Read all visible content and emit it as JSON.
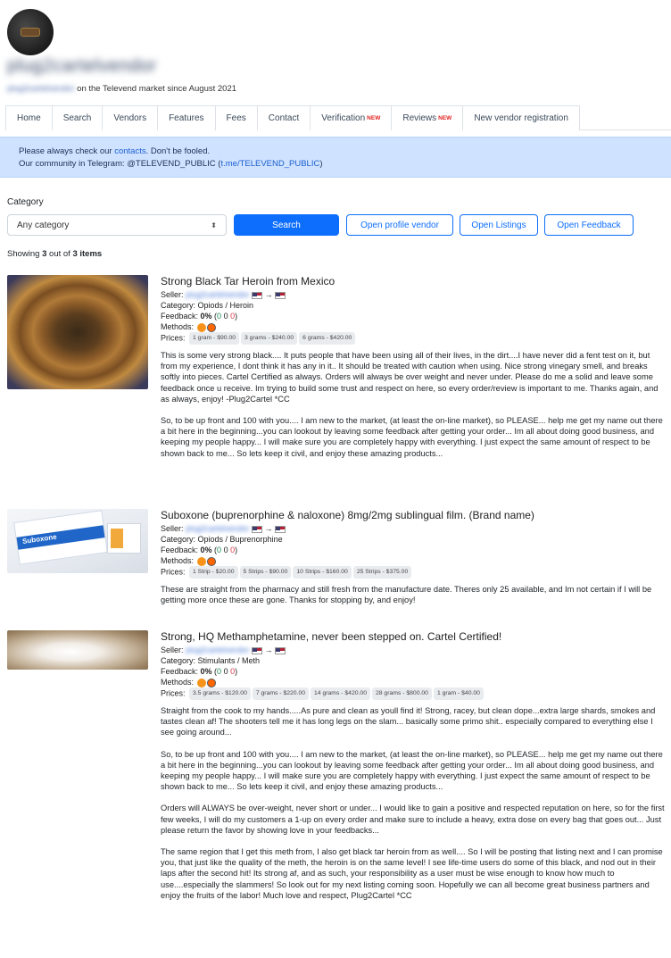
{
  "header": {
    "vendor_name": "plug2cartelvendor",
    "since_prefix": "plug2cartelvendor",
    "since_text": " on the Televend market since August 2021"
  },
  "nav": {
    "items": [
      {
        "label": "Home",
        "new": ""
      },
      {
        "label": "Search",
        "new": ""
      },
      {
        "label": "Vendors",
        "new": ""
      },
      {
        "label": "Features",
        "new": ""
      },
      {
        "label": "Fees",
        "new": ""
      },
      {
        "label": "Contact",
        "new": ""
      },
      {
        "label": "Verification",
        "new": "NEW"
      },
      {
        "label": "Reviews",
        "new": "NEW"
      },
      {
        "label": "New vendor registration",
        "new": ""
      }
    ]
  },
  "alert": {
    "line1_prefix": "Please always check our ",
    "line1_link": "contacts",
    "line1_suffix": ". Don't be fooled.",
    "line2_prefix": "Our community in Telegram: @TELEVEND_PUBLIC (",
    "line2_link": "t.me/TELEVEND_PUBLIC",
    "line2_suffix": ")"
  },
  "filters": {
    "category_label": "Category",
    "category_value": "Any category",
    "search_label": "Search",
    "open_profile_label": "Open profile vendor",
    "open_listings_label": "Open Listings",
    "open_feedback_label": "Open Feedback"
  },
  "results": {
    "prefix": "Showing ",
    "shown": "3",
    "middle": " out of ",
    "total": "3 items"
  },
  "labels": {
    "seller": "Seller: ",
    "seller_name": "plug2cartelvendor",
    "arrow": "→",
    "category": "Category: ",
    "feedback": "Feedback: ",
    "methods": "Methods: ",
    "prices": "Prices: "
  },
  "listings": [
    {
      "title": "Strong Black Tar Heroin from Mexico",
      "category": "Opiods / Heroin",
      "feedback_pct": "0%",
      "feedback_pos": "0",
      "feedback_neu": "0",
      "feedback_neg": "0",
      "prices": [
        "1 gram - $90.00",
        "3 grams - $240.00",
        "6 grams - $420.00"
      ],
      "desc": [
        "This is some very strong black.... It puts people that have been using all of their lives, in the dirt....I have never did a fent test on it, but from my experience, I dont think it has any in it.. It should be treated with caution when using. Nice strong vinegary smell, and breaks softly into pieces. Cartel Certified as always. Orders will always be over weight and never under. Please do me a solid and leave some feedback once u receive. Im trying to build some trust and respect on here, so every order/review is important to me. Thanks again, and as always, enjoy! -Plug2Cartel *CC",
        "So, to be up front and 100 with you.... I am new to the market, (at least the on-line market), so PLEASE... help me get my name out there a bit here in the beginning...you can lookout by leaving some feedback after getting your order... Im all about doing good business, and keeping my people happy... I will make sure you are completely happy with everything. I just expect the same amount of respect to be shown back to me... So lets keep it civil, and enjoy these amazing products..."
      ]
    },
    {
      "title": "Suboxone (buprenorphine & naloxone) 8mg/2mg sublingual film. (Brand name)",
      "category": "Opiods / Buprenorphine",
      "feedback_pct": "0%",
      "feedback_pos": "0",
      "feedback_neu": "0",
      "feedback_neg": "0",
      "prices": [
        "1 Strip - $20.00",
        "5 Strips - $90.00",
        "10 Strips - $160.00",
        "25 Strips - $375.00"
      ],
      "desc": [
        "These are straight from the pharmacy and still fresh from the manufacture date. Theres only 25 available, and Im not certain if I will be getting more once these are gone. Thanks for stopping by, and enjoy!"
      ]
    },
    {
      "title": "Strong, HQ Methamphetamine, never been stepped on. Cartel Certified!",
      "category": "Stimulants / Meth",
      "feedback_pct": "0%",
      "feedback_pos": "0",
      "feedback_neu": "0",
      "feedback_neg": "0",
      "prices": [
        "3.5 grams - $120.00",
        "7 grams - $220.00",
        "14 grams - $420.00",
        "28 grams - $800.00",
        "1 gram - $40.00"
      ],
      "desc": [
        "Straight from the cook to my hands.....As pure and clean as youll find it! Strong, racey, but clean dope...extra large shards, smokes and tastes clean af! The shooters tell me it has long legs on the slam... basically some primo shit.. especially compared to everything else I see going around...",
        "So, to be up front and 100 with you.... I am new to the market, (at least the on-line market), so PLEASE... help me get my name out there a bit here in the beginning...you can lookout by leaving some feedback after getting your order... Im all about doing good business, and keeping my people happy... I will make sure you are completely happy with everything. I just expect the same amount of respect to be shown back to me... So lets keep it civil, and enjoy these amazing products...",
        "Orders will ALWAYS be over-weight, never short or under... I would like to gain a positive and respected reputation on here, so for the first few weeks, I will do my customers a 1-up on every order and make sure to include a heavy, extra dose on every bag that goes out... Just please return the favor by showing love in your feedbacks...",
        "The same region that I get this meth from, I also get black tar heroin from as well.... So I will be posting that listing next and I can promise you, that just like the quality of the meth, the heroin is on the same level! I see life-time users do some of this black, and nod out in their laps after the second hit! Its strong af, and as such, your responsibility as a user must be wise enough to know how much to use....especially the slammers! So look out for my next listing coming soon. Hopefully we can all become great business partners and enjoy the fruits of the labor! Much love and respect, Plug2Cartel *CC"
      ]
    }
  ],
  "image_text": {
    "suboxone_pack": "Suboxone"
  }
}
